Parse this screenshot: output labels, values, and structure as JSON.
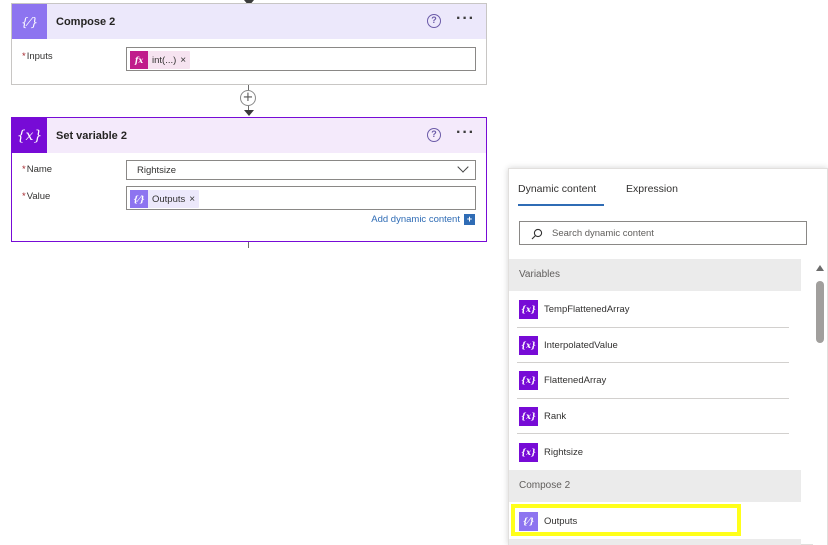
{
  "colors": {
    "compose_accent": "#8d74f0",
    "compose_header_bg": "#ece8fb",
    "variable_accent": "#770bd6",
    "variable_header_bg": "#f4eafb",
    "expression_token": "#c01c8b",
    "link_blue": "#2f6cb5",
    "highlight_yellow": "#ffff1a"
  },
  "compose_card": {
    "icon": "compose-curly-icon",
    "icon_glyph": "{⁄}",
    "title": "Compose 2",
    "help_glyph": "?",
    "more_glyph": "···",
    "inputs_label": "Inputs",
    "required_mark": "*",
    "token": {
      "icon_glyph": "fx",
      "label": "int(...)",
      "remove": "×"
    }
  },
  "connector": {
    "plus_glyph": "+"
  },
  "set_variable_card": {
    "icon": "variable-curly-icon",
    "icon_glyph": "{x}",
    "title": "Set variable 2",
    "help_glyph": "?",
    "more_glyph": "···",
    "required_mark": "*",
    "name_label": "Name",
    "name_value": "Rightsize",
    "value_label": "Value",
    "value_token": {
      "icon_glyph": "{⁄}",
      "label": "Outputs",
      "remove": "×"
    },
    "add_dynamic_link": "Add dynamic content",
    "add_dynamic_glyph": "+"
  },
  "dynamic_panel": {
    "tabs": [
      {
        "label": "Dynamic content",
        "active": true
      },
      {
        "label": "Expression",
        "active": false
      }
    ],
    "search_placeholder": "Search dynamic content",
    "sections": [
      {
        "header": "Variables",
        "items": [
          {
            "label": "TempFlattenedArray",
            "icon_glyph": "{x}"
          },
          {
            "label": "InterpolatedValue",
            "icon_glyph": "{x}"
          },
          {
            "label": "FlattenedArray",
            "icon_glyph": "{x}"
          },
          {
            "label": "Rank",
            "icon_glyph": "{x}"
          },
          {
            "label": "Rightsize",
            "icon_glyph": "{x}"
          }
        ]
      },
      {
        "header": "Compose 2",
        "items": [
          {
            "label": "Outputs",
            "icon_glyph": "{⁄}",
            "highlighted": true
          }
        ]
      }
    ]
  }
}
